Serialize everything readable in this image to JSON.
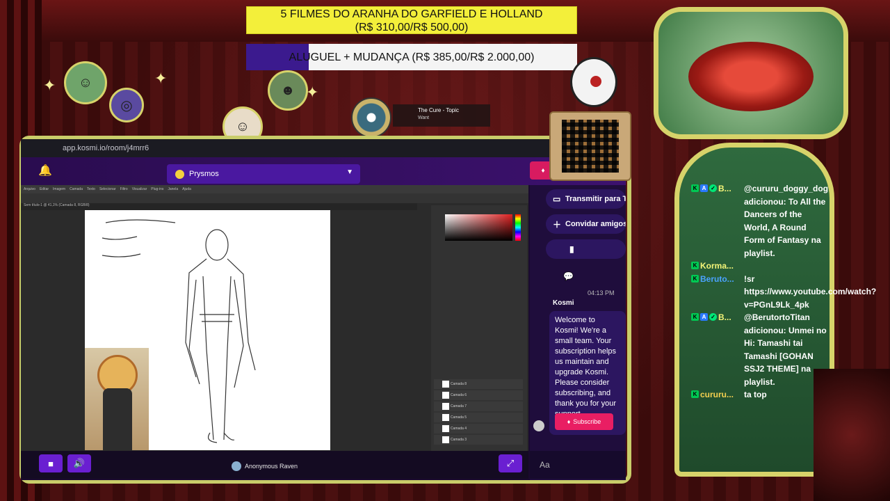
{
  "goals": {
    "goal1": "5 FILMES DO ARANHA DO GARFIELD E HOLLAND (R$ 310,00/R$ 500,00)",
    "goal1_progress": 0.62,
    "goal2": "ALUGUEL + MUDANÇA (R$ 385,00/R$ 2.000,00)",
    "goal2_progress": 0.19
  },
  "browser": {
    "url": "app.kosmi.io/room/j4mrr6"
  },
  "kosmi": {
    "room_name": "Prysmos",
    "side_buttons": [
      {
        "label": "Transmitir para TV",
        "icon": "cast-icon"
      },
      {
        "label": "Convidar amigos",
        "icon": "add-user-icon"
      }
    ],
    "chat_time": "04:13 PM",
    "chat_user": "Kosmi",
    "chat_message": "Welcome to Kosmi! We're a small team. Your subscription helps us maintain and upgrade Kosmi. Please consider subscribing, and thank you for your support.",
    "subscribe_label": "Subscribe",
    "chat_placeholder": "Aa",
    "viewer_name": "Anonymous Raven"
  },
  "photoshop": {
    "menu": [
      "Arquivo",
      "Editar",
      "Imagem",
      "Camada",
      "Texto",
      "Selecionar",
      "Filtro",
      "Visualizar",
      "Plug-ins",
      "Janela",
      "Ajuda"
    ],
    "doc_tab": "Sem título-1 @ 41,1% (Camada 8, RGB/8)",
    "layers": [
      "Camada 8",
      "Camada 6",
      "Camada 7",
      "Camada 5",
      "Camada 4",
      "Camada 3"
    ]
  },
  "music": {
    "title": "The Cure - Topic",
    "track": "Want"
  },
  "twitch_chat": [
    {
      "name": "B...",
      "badges": [
        "k",
        "b",
        "v"
      ],
      "text": "@cururu_doggy_dog adicionou: To All the Dancers of the World, A Round Form of Fantasy na playlist.",
      "name_color": "#f4f478"
    },
    {
      "name": "Korma...",
      "badges": [
        "k"
      ],
      "text": "",
      "name_color": "#f4f478"
    },
    {
      "name": "Beruto...",
      "badges": [
        "k"
      ],
      "text": "!sr https://www.youtube.com/watch?v=PGnL9Lk_4pk",
      "name_color": "#4aa3ff"
    },
    {
      "name": "B...",
      "badges": [
        "k",
        "b",
        "v"
      ],
      "text": "@BerutortoTitan adicionou: Unmei no Hi: Tamashi tai Tamashi [GOHAN SSJ2 THEME] na playlist.",
      "name_color": "#f4f478"
    },
    {
      "name": "cururu...",
      "badges": [
        "k"
      ],
      "text": "ta top",
      "name_color": "#f4d050"
    }
  ],
  "colors": {
    "goal1_bg": "#f3ef3a",
    "goal2_fill": "#3b1a8e",
    "kosmi_purple": "#6a1fd1",
    "subscribe_pink": "#e91e63",
    "frame_gold": "#d7d36a"
  }
}
